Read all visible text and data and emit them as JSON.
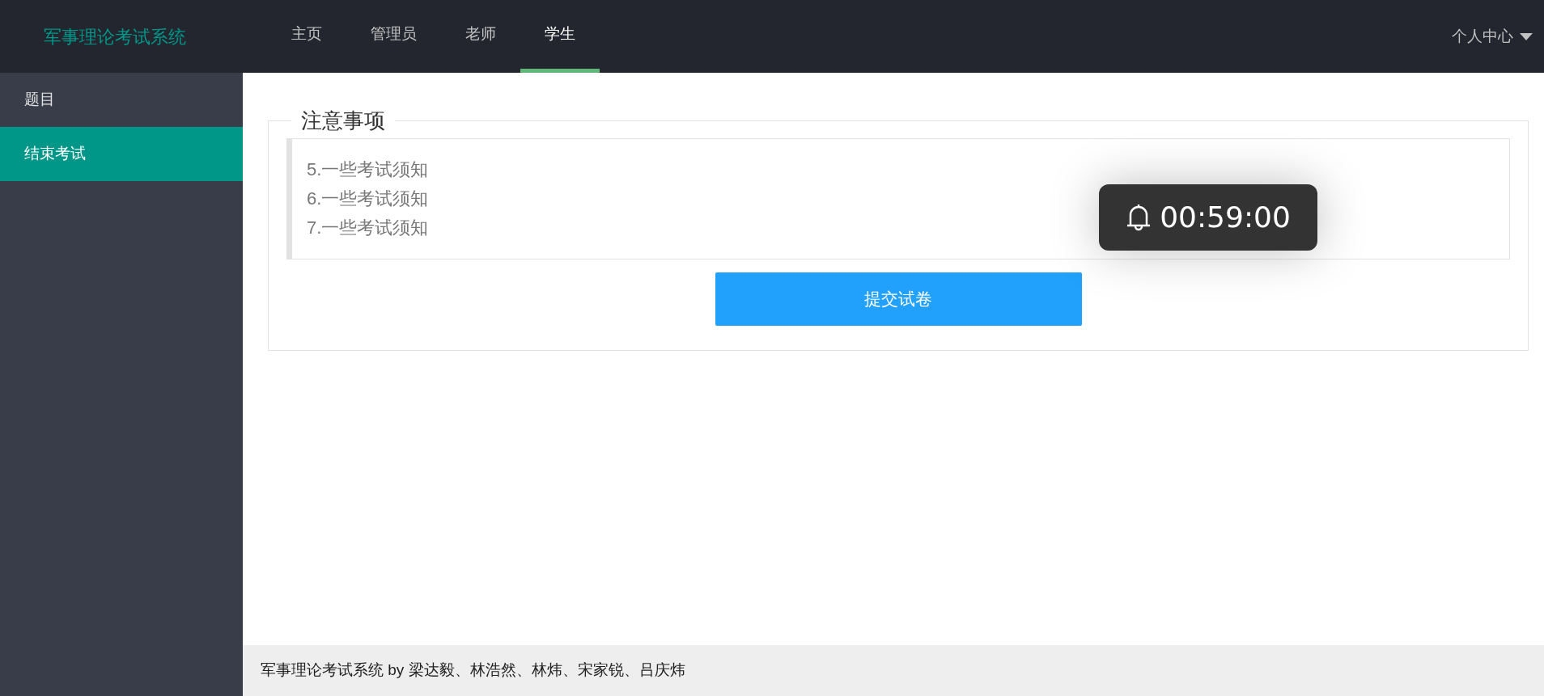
{
  "header": {
    "logo": "军事理论考试系统",
    "nav": [
      {
        "label": "主页",
        "selected": false
      },
      {
        "label": "管理员",
        "selected": false
      },
      {
        "label": "老师",
        "selected": false
      },
      {
        "label": "学生",
        "selected": true
      }
    ],
    "user_menu": "个人中心"
  },
  "sidebar": {
    "items": [
      {
        "label": "题目",
        "selected": false
      },
      {
        "label": "结束考试",
        "selected": true
      }
    ]
  },
  "notice": {
    "title": "注意事项",
    "lines": [
      "5.一些考试须知",
      "6.一些考试须知",
      "7.一些考试须知"
    ]
  },
  "submit_button": "提交试卷",
  "timer": "00:59:00",
  "footer": "军事理论考试系统 by 梁达毅、林浩然、林炜、宋家锐、吕庆炜"
}
